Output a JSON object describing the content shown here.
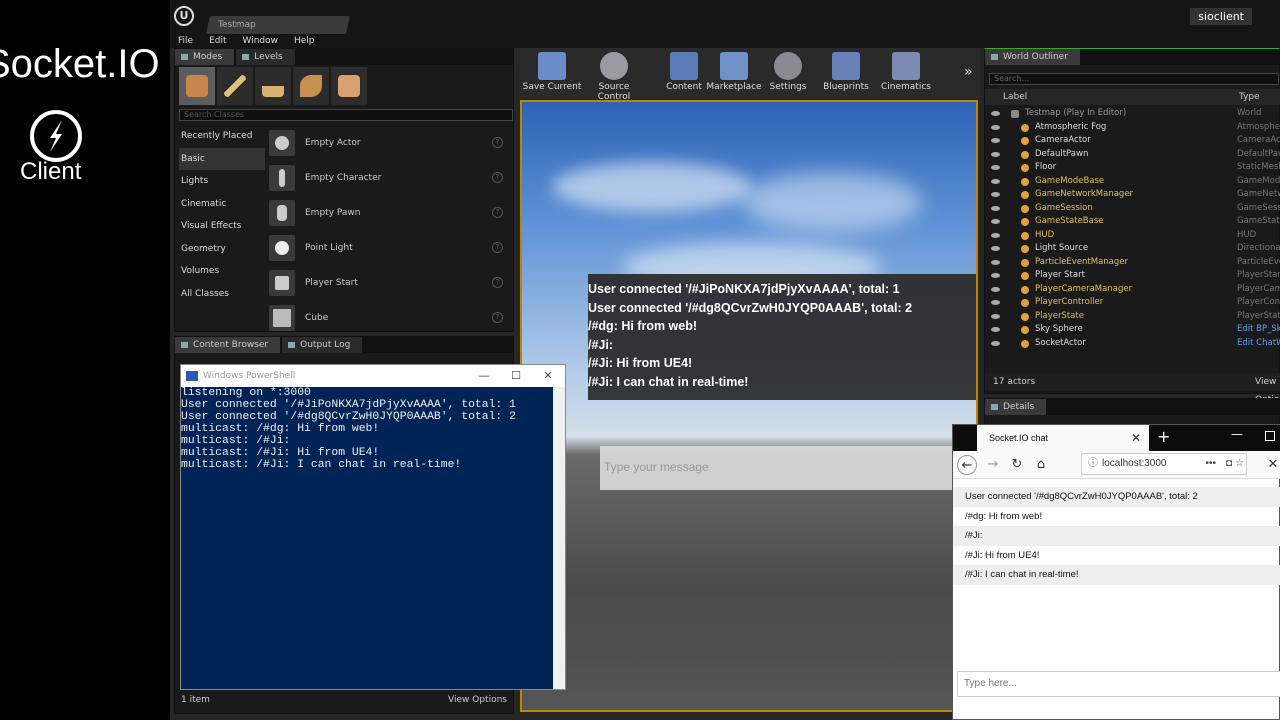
{
  "brand": {
    "title": "Socket.IO",
    "subtitle": "Client"
  },
  "editor": {
    "map_tab": "Testmap",
    "project": "sioclient",
    "menu": [
      "File",
      "Edit",
      "Window",
      "Help"
    ],
    "modes_tabs": [
      "Modes",
      "Levels"
    ],
    "search_classes_placeholder": "Search Classes",
    "categories": [
      "Recently Placed",
      "Basic",
      "Lights",
      "Cinematic",
      "Visual Effects",
      "Geometry",
      "Volumes",
      "All Classes"
    ],
    "classes": [
      "Empty Actor",
      "Empty Character",
      "Empty Pawn",
      "Point Light",
      "Player Start",
      "Cube"
    ],
    "toolbar": [
      "Save Current",
      "Source Control",
      "Content",
      "Marketplace",
      "Settings",
      "Blueprints",
      "Cinematics"
    ],
    "content_tabs": [
      "Content Browser",
      "Output Log"
    ],
    "content_footer": {
      "items": "1 item",
      "view_options": "View Options"
    },
    "viewport": {
      "chat_lines": [
        "User connected '/#JiPoNKXA7jdPjyXvAAAA', total: 1",
        "User connected '/#dg8QCvrZwH0JYQP0AAAB', total: 2",
        "/#dg: Hi from web!",
        "/#Ji:",
        "/#Ji: Hi from UE4!",
        "/#Ji: I can chat in real-time!"
      ],
      "input_placeholder": "Type your message"
    },
    "outliner": {
      "tab": "World Outliner",
      "search_placeholder": "Search...",
      "col_label": "Label",
      "col_type": "Type",
      "rows": [
        {
          "label": "Testmap (Play In Editor)",
          "type": "World"
        },
        {
          "label": "Atmospheric Fog",
          "type": "AtmosphericFog"
        },
        {
          "label": "CameraActor",
          "type": "CameraActor"
        },
        {
          "label": "DefaultPawn",
          "type": "DefaultPawn"
        },
        {
          "label": "Floor",
          "type": "StaticMeshActor"
        },
        {
          "label": "GameModeBase",
          "type": "GameModeBase"
        },
        {
          "label": "GameNetworkManager",
          "type": "GameNetworkManager"
        },
        {
          "label": "GameSession",
          "type": "GameSession"
        },
        {
          "label": "GameStateBase",
          "type": "GameStateBase"
        },
        {
          "label": "HUD",
          "type": "HUD"
        },
        {
          "label": "Light Source",
          "type": "DirectionalLight"
        },
        {
          "label": "ParticleEventManager",
          "type": "ParticleEventManager"
        },
        {
          "label": "Player Start",
          "type": "PlayerStart"
        },
        {
          "label": "PlayerCameraManager",
          "type": "PlayerCameraManager"
        },
        {
          "label": "PlayerController",
          "type": "PlayerController"
        },
        {
          "label": "PlayerState",
          "type": "PlayerState"
        },
        {
          "label": "Sky Sphere",
          "type": "Edit BP_Sky_Sphere"
        },
        {
          "label": "SocketActor",
          "type": "Edit ChatWidget"
        }
      ],
      "footer": "17 actors",
      "view": "View Options"
    },
    "details_tab": "Details"
  },
  "powershell": {
    "title": "Windows PowerShell",
    "lines": [
      "listening on *:3000",
      "User connected '/#JiPoNKXA7jdPjyXvAAAA', total: 1",
      "",
      "User connected '/#dg8QCvrZwH0JYQP0AAAB', total: 2",
      "multicast: /#dg: Hi from web!",
      "multicast: /#Ji:",
      "multicast: /#Ji: Hi from UE4!",
      "multicast: /#Ji: I can chat in real-time!"
    ]
  },
  "browser": {
    "tab_title": "Socket.IO chat",
    "url": "localhost:3000",
    "messages": [
      "User connected '/#dg8QCvrZwH0JYQP0AAAB', total: 2",
      "/#dg: Hi from web!",
      "/#Ji:",
      "/#Ji: Hi from UE4!",
      "/#Ji: I can chat in real-time!"
    ],
    "input_placeholder": "Type here..."
  }
}
